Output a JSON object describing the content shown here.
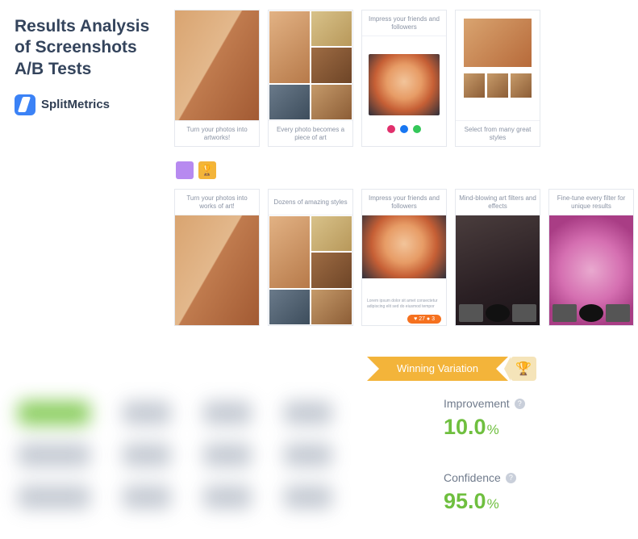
{
  "header": {
    "title": "Results Analysis of Screenshots A/B Tests",
    "brand": "SplitMetrics"
  },
  "variationA": {
    "cards": [
      {
        "caption": "Turn your photos into artworks!"
      },
      {
        "caption": "Every photo becomes a piece of art"
      },
      {
        "caption": "Impress your friends and followers"
      },
      {
        "caption": "Select from many great styles"
      }
    ]
  },
  "swatches": {
    "trophy_glyph": "🏆"
  },
  "variationB": {
    "cards": [
      {
        "caption": "Turn your photos into works of art!"
      },
      {
        "caption": "Dozens of amazing styles"
      },
      {
        "caption": "Impress your friends and followers"
      },
      {
        "caption": "Mind-blowing art filters and effects"
      },
      {
        "caption": "Fine-tune every filter for unique results"
      }
    ]
  },
  "banner": {
    "label": "Winning Variation",
    "trophy_glyph": "🏆"
  },
  "metrics": {
    "improvement": {
      "label": "Improvement",
      "value": "10.0",
      "unit": "%"
    },
    "confidence": {
      "label": "Confidence",
      "value": "95.0",
      "unit": "%"
    }
  },
  "help_glyph": "?"
}
